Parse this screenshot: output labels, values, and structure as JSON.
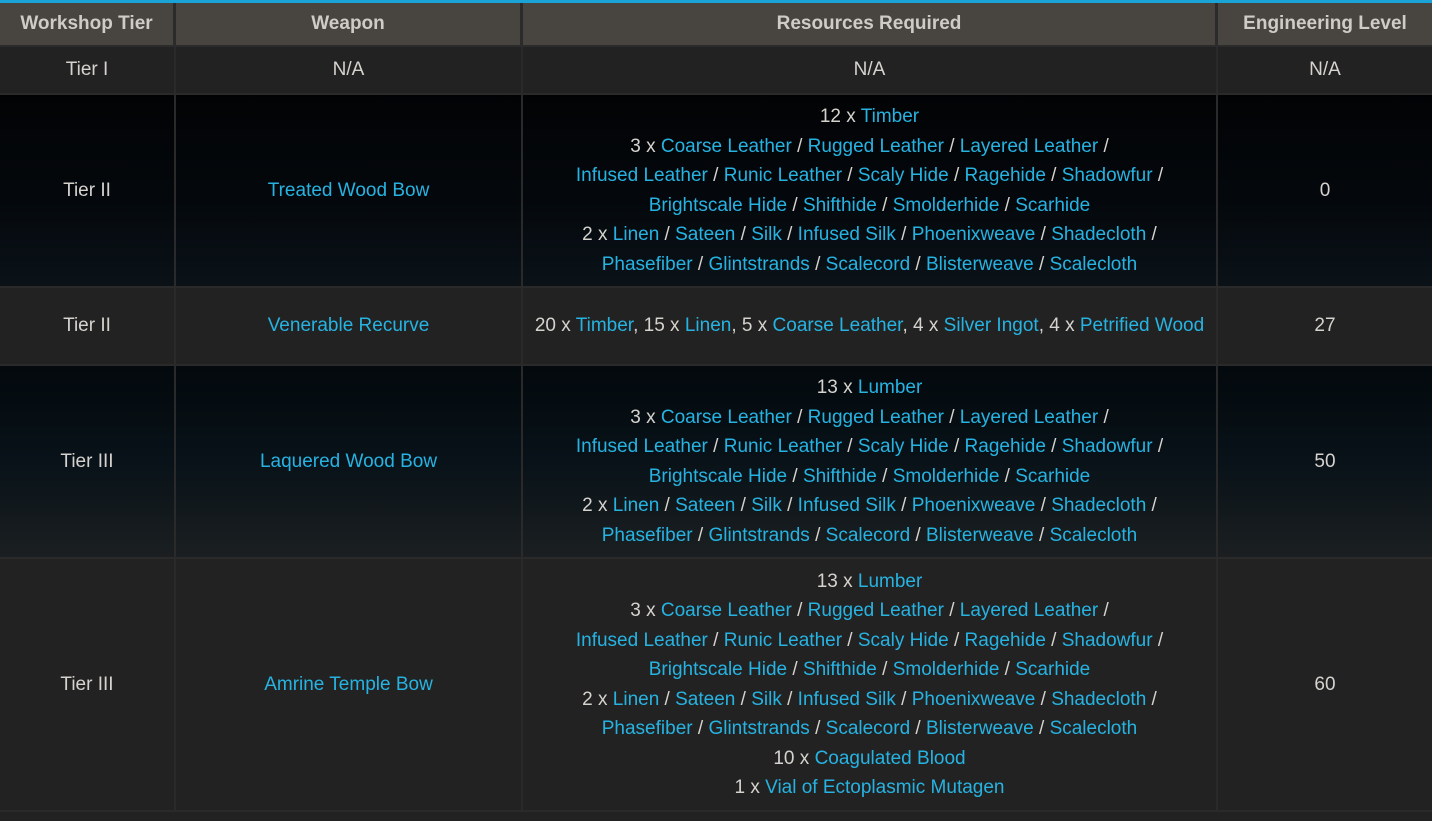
{
  "colors": {
    "accent": "#1aa3d6",
    "link": "#27b3e2",
    "header_bg": "#48443f",
    "row_bg": "#222222",
    "text": "#d6d3cf"
  },
  "headers": [
    "Workshop Tier",
    "Weapon",
    "Resources Required",
    "Engineering Level"
  ],
  "leather_options": [
    "Coarse Leather",
    "Rugged Leather",
    "Layered Leather",
    "Infused Leather",
    "Runic Leather",
    "Scaly Hide",
    "Ragehide",
    "Shadowfur",
    "Brightscale Hide",
    "Shifthide",
    "Smolderhide",
    "Scarhide"
  ],
  "cloth_options": [
    "Linen",
    "Sateen",
    "Silk",
    "Infused Silk",
    "Phoenixweave",
    "Shadecloth",
    "Phasefiber",
    "Glintstrands",
    "Scalecord",
    "Blisterweave",
    "Scalecloth"
  ],
  "rows": [
    {
      "tier": "Tier I",
      "weapon": "N/A",
      "weapon_link": false,
      "resources_text": "N/A",
      "level": "N/A"
    },
    {
      "tier": "Tier II",
      "weapon": "Treated Wood Bow",
      "weapon_link": true,
      "level": "0",
      "resources": [
        {
          "qty": "12 x",
          "items": [
            "Timber"
          ]
        },
        {
          "qty": "3 x",
          "items": "leather"
        },
        {
          "qty": "2 x",
          "items": "cloth"
        }
      ]
    },
    {
      "tier": "Tier II",
      "weapon": "Venerable Recurve",
      "weapon_link": true,
      "level": "27",
      "resources_inline": [
        {
          "qty": "20 x",
          "item": "Timber"
        },
        {
          "qty": "15 x",
          "item": "Linen"
        },
        {
          "qty": "5 x",
          "item": "Coarse Leather"
        },
        {
          "qty": "4 x",
          "item": "Silver Ingot"
        },
        {
          "qty": "4 x",
          "item": "Petrified Wood"
        }
      ]
    },
    {
      "tier": "Tier III",
      "weapon": "Laquered Wood Bow",
      "weapon_link": true,
      "level": "50",
      "resources": [
        {
          "qty": "13 x",
          "items": [
            "Lumber"
          ]
        },
        {
          "qty": "3 x",
          "items": "leather"
        },
        {
          "qty": "2 x",
          "items": "cloth"
        }
      ]
    },
    {
      "tier": "Tier III",
      "weapon": "Amrine Temple Bow",
      "weapon_link": true,
      "level": "60",
      "resources": [
        {
          "qty": "13 x",
          "items": [
            "Lumber"
          ]
        },
        {
          "qty": "3 x",
          "items": "leather"
        },
        {
          "qty": "2 x",
          "items": "cloth"
        },
        {
          "qty": "10 x",
          "items": [
            "Coagulated Blood"
          ]
        },
        {
          "qty": "1 x",
          "items": [
            "Vial of Ectoplasmic Mutagen"
          ]
        }
      ]
    }
  ]
}
